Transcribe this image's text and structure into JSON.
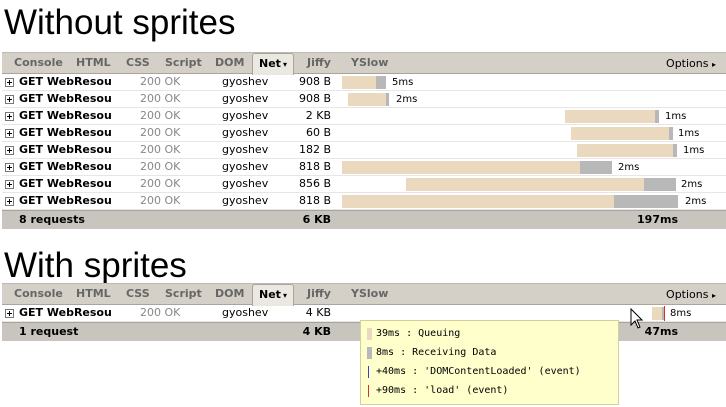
{
  "headings": {
    "without": "Without sprites",
    "with": "With sprites"
  },
  "tabs": [
    {
      "label": "Console"
    },
    {
      "label": "HTML"
    },
    {
      "label": "CSS"
    },
    {
      "label": "Script"
    },
    {
      "label": "DOM"
    },
    {
      "label": "Net",
      "active": true,
      "caret": "▾"
    },
    {
      "label": "Jiffy"
    },
    {
      "label": "YSlow"
    }
  ],
  "options": {
    "label": "Options",
    "caret": "▸"
  },
  "colors": {
    "queuing": "#ebd9bf",
    "receiving": "#b8b8b8",
    "dom_content_loaded": "#3b3bcc",
    "load": "#cc3333",
    "tooltip_bg": "#ffffcc"
  },
  "without": {
    "requests": [
      {
        "url": "GET WebResource",
        "status": "200 OK",
        "domain": "gyoshev",
        "size": "908 B",
        "time": "5ms"
      },
      {
        "url": "GET WebResource",
        "status": "200 OK",
        "domain": "gyoshev",
        "size": "908 B",
        "time": "2ms"
      },
      {
        "url": "GET WebResource",
        "status": "200 OK",
        "domain": "gyoshev",
        "size": "2 KB",
        "time": "1ms"
      },
      {
        "url": "GET WebResource",
        "status": "200 OK",
        "domain": "gyoshev",
        "size": "60 B",
        "time": "1ms"
      },
      {
        "url": "GET WebResource",
        "status": "200 OK",
        "domain": "gyoshev",
        "size": "182 B",
        "time": "1ms"
      },
      {
        "url": "GET WebResource",
        "status": "200 OK",
        "domain": "gyoshev",
        "size": "818 B",
        "time": "2ms"
      },
      {
        "url": "GET WebResource",
        "status": "200 OK",
        "domain": "gyoshev",
        "size": "856 B",
        "time": "2ms"
      },
      {
        "url": "GET WebResource",
        "status": "200 OK",
        "domain": "gyoshev",
        "size": "818 B",
        "time": "2ms"
      }
    ],
    "summary": {
      "requests": "8 requests",
      "size": "6 KB",
      "time": "197ms"
    }
  },
  "with": {
    "requests": [
      {
        "url": "GET WebResource",
        "status": "200 OK",
        "domain": "gyoshev",
        "size": "4 KB",
        "time": "8ms"
      }
    ],
    "summary": {
      "requests": "1 request",
      "size": "4 KB",
      "time": "47ms"
    }
  },
  "tooltip": {
    "lines": [
      {
        "text": "39ms : Queuing"
      },
      {
        "text": "8ms : Receiving Data"
      },
      {
        "text": "+40ms : 'DOMContentLoaded' (event)"
      },
      {
        "text": "+90ms : 'load' (event)"
      }
    ]
  }
}
